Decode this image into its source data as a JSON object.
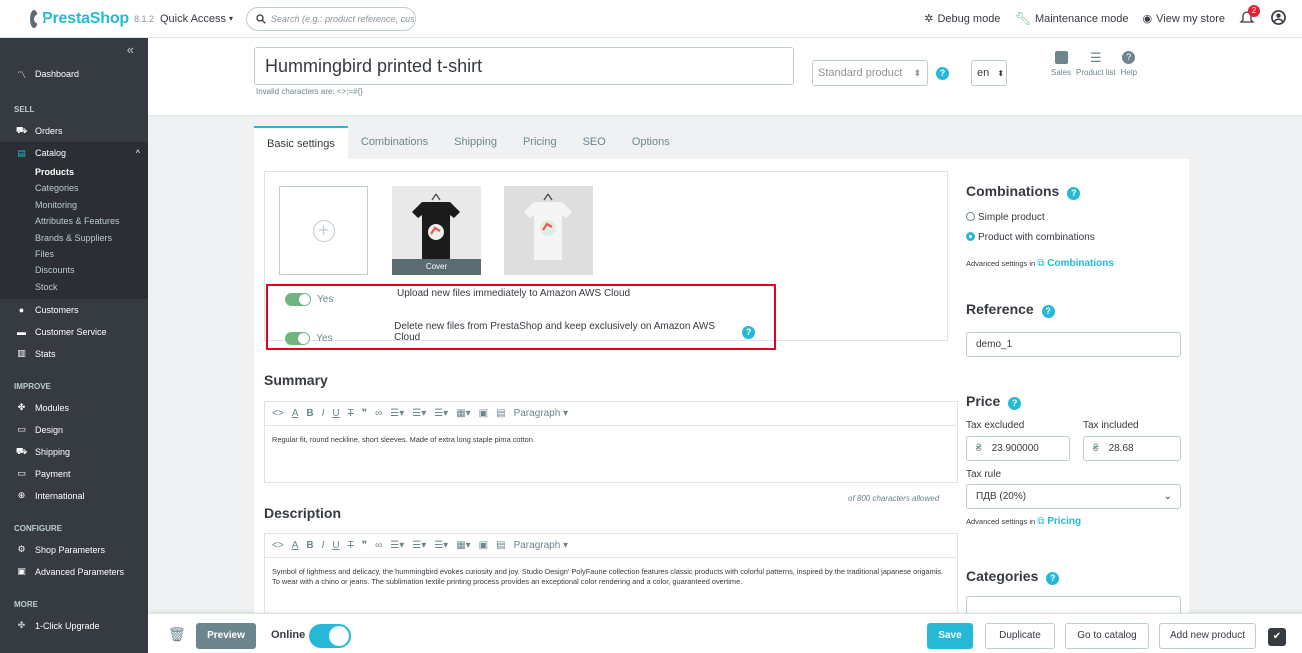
{
  "header": {
    "brand": "PrestaShop",
    "version": "8.1.2",
    "quick_access": "Quick Access",
    "search_placeholder": "Search (e.g.: product reference, custon",
    "debug_mode": "Debug mode",
    "maintenance_mode": "Maintenance mode",
    "view_store": "View my store",
    "notif_count": "2"
  },
  "sidebar": {
    "dashboard": "Dashboard",
    "sec_sell": "SELL",
    "orders": "Orders",
    "catalog": "Catalog",
    "catalog_sub": [
      "Products",
      "Categories",
      "Monitoring",
      "Attributes & Features",
      "Brands & Suppliers",
      "Files",
      "Discounts",
      "Stock"
    ],
    "customers": "Customers",
    "customer_service": "Customer Service",
    "stats": "Stats",
    "sec_improve": "IMPROVE",
    "modules": "Modules",
    "design": "Design",
    "shipping": "Shipping",
    "payment": "Payment",
    "international": "International",
    "sec_configure": "CONFIGURE",
    "shop_parameters": "Shop Parameters",
    "advanced_parameters": "Advanced Parameters",
    "sec_more": "MORE",
    "one_click": "1-Click Upgrade"
  },
  "product": {
    "name": "Hummingbird printed t-shirt",
    "invalid_chars": "Invalid characters are: <>;=#{}",
    "type": "Standard product",
    "lang": "en",
    "tool_sales": "Sales",
    "tool_list": "Product list",
    "tool_help": "Help"
  },
  "tabs": [
    "Basic settings",
    "Combinations",
    "Shipping",
    "Pricing",
    "SEO",
    "Options"
  ],
  "images": {
    "cover_label": "Cover"
  },
  "aws": {
    "yes": "Yes",
    "upload_label": "Upload new files immediately to Amazon AWS Cloud",
    "delete_label": "Delete new files from PrestaShop and keep exclusively on Amazon AWS Cloud"
  },
  "summary": {
    "title": "Summary",
    "paragraph": "Paragraph",
    "text": "Regular fit, round neckline, short sleeves. Made of extra long staple pima cotton.",
    "counter": "of 800 characters allowed"
  },
  "description": {
    "title": "Description",
    "paragraph": "Paragraph",
    "text": "Symbol of lightness and delicacy, the hummingbird evokes curiosity and joy. Studio Design' PolyFaune collection features classic products with colorful patterns, inspired by the traditional japanese origamis. To wear with a chino or jeans. The sublimation textile printing process provides an exceptional color rendering and a color, guaranteed overtime."
  },
  "combinations": {
    "title": "Combinations",
    "simple": "Simple product",
    "with": "Product with combinations",
    "adv_prefix": "Advanced settings in",
    "adv_link": "Combinations"
  },
  "reference": {
    "title": "Reference",
    "value": "demo_1"
  },
  "price": {
    "title": "Price",
    "tax_excl_label": "Tax excluded",
    "tax_incl_label": "Tax included",
    "currency": "₴",
    "tax_excl": "23.900000",
    "tax_incl": "28.68",
    "tax_rule_label": "Tax rule",
    "tax_rule": "ПДВ (20%)",
    "adv_prefix": "Advanced settings in",
    "adv_link": "Pricing"
  },
  "categories": {
    "title": "Categories"
  },
  "footer": {
    "preview": "Preview",
    "online": "Online",
    "save": "Save",
    "duplicate": "Duplicate",
    "go_catalog": "Go to catalog",
    "add_new": "Add new product"
  },
  "colors": {
    "accent": "#25b9d7",
    "sidebar": "#363a41",
    "toggle_on": "#70b580",
    "highlight": "#e5001d"
  }
}
